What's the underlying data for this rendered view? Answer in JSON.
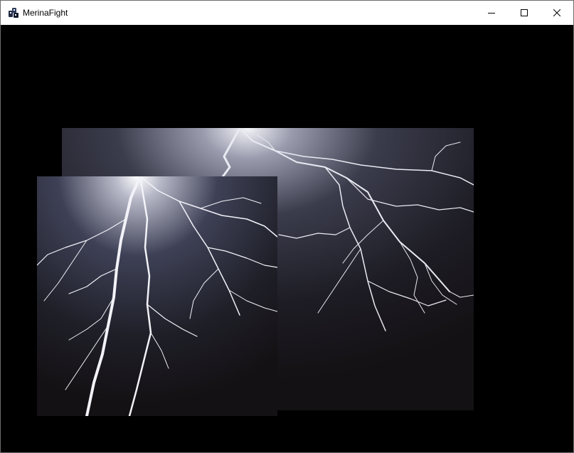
{
  "window": {
    "title": "MerinaFight",
    "app_icon": "app-logo-icon",
    "controls": {
      "minimize_icon": "minimize-icon",
      "maximize_icon": "maximize-icon",
      "close_icon": "close-icon"
    }
  },
  "canvas": {
    "background_color": "#000000",
    "sprites": [
      {
        "name": "lightning-sprite-large",
        "image": "lightning-bolt"
      },
      {
        "name": "lightning-sprite-small",
        "image": "lightning-bolt"
      }
    ]
  }
}
